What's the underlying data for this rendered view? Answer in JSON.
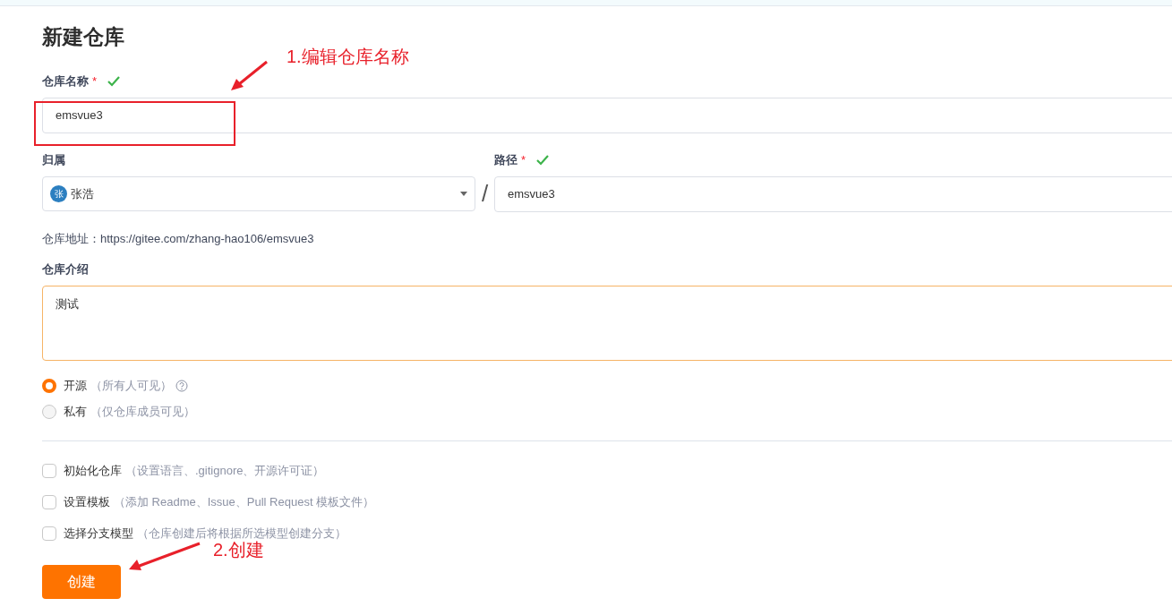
{
  "title": "新建仓库",
  "name_field": {
    "label": "仓库名称",
    "required_mark": "*",
    "valid": true,
    "value": "emsvue3"
  },
  "owner_field": {
    "label": "归属",
    "avatar_text": "张",
    "value": "张浩"
  },
  "separator": "/",
  "path_field": {
    "label": "路径",
    "required_mark": "*",
    "valid": true,
    "value": "emsvue3"
  },
  "address": "仓库地址：https://gitee.com/zhang-hao106/emsvue3",
  "intro_field": {
    "label": "仓库介绍",
    "value": "测试"
  },
  "visibility": [
    {
      "label": "开源",
      "hint": "（所有人可见）",
      "selected": true,
      "help": true
    },
    {
      "label": "私有",
      "hint": "（仅仓库成员可见）",
      "selected": false,
      "help": false
    }
  ],
  "options": [
    {
      "label": "初始化仓库",
      "hint": "（设置语言、.gitignore、开源许可证）",
      "checked": false
    },
    {
      "label": "设置模板",
      "hint": "（添加 Readme、Issue、Pull Request 模板文件）",
      "checked": false
    },
    {
      "label": "选择分支模型",
      "hint": "（仓库创建后将根据所选模型创建分支）",
      "checked": false
    }
  ],
  "create_button": "创建",
  "annotations": [
    {
      "text": "1.编辑仓库名称"
    },
    {
      "text": "2.创建"
    }
  ]
}
